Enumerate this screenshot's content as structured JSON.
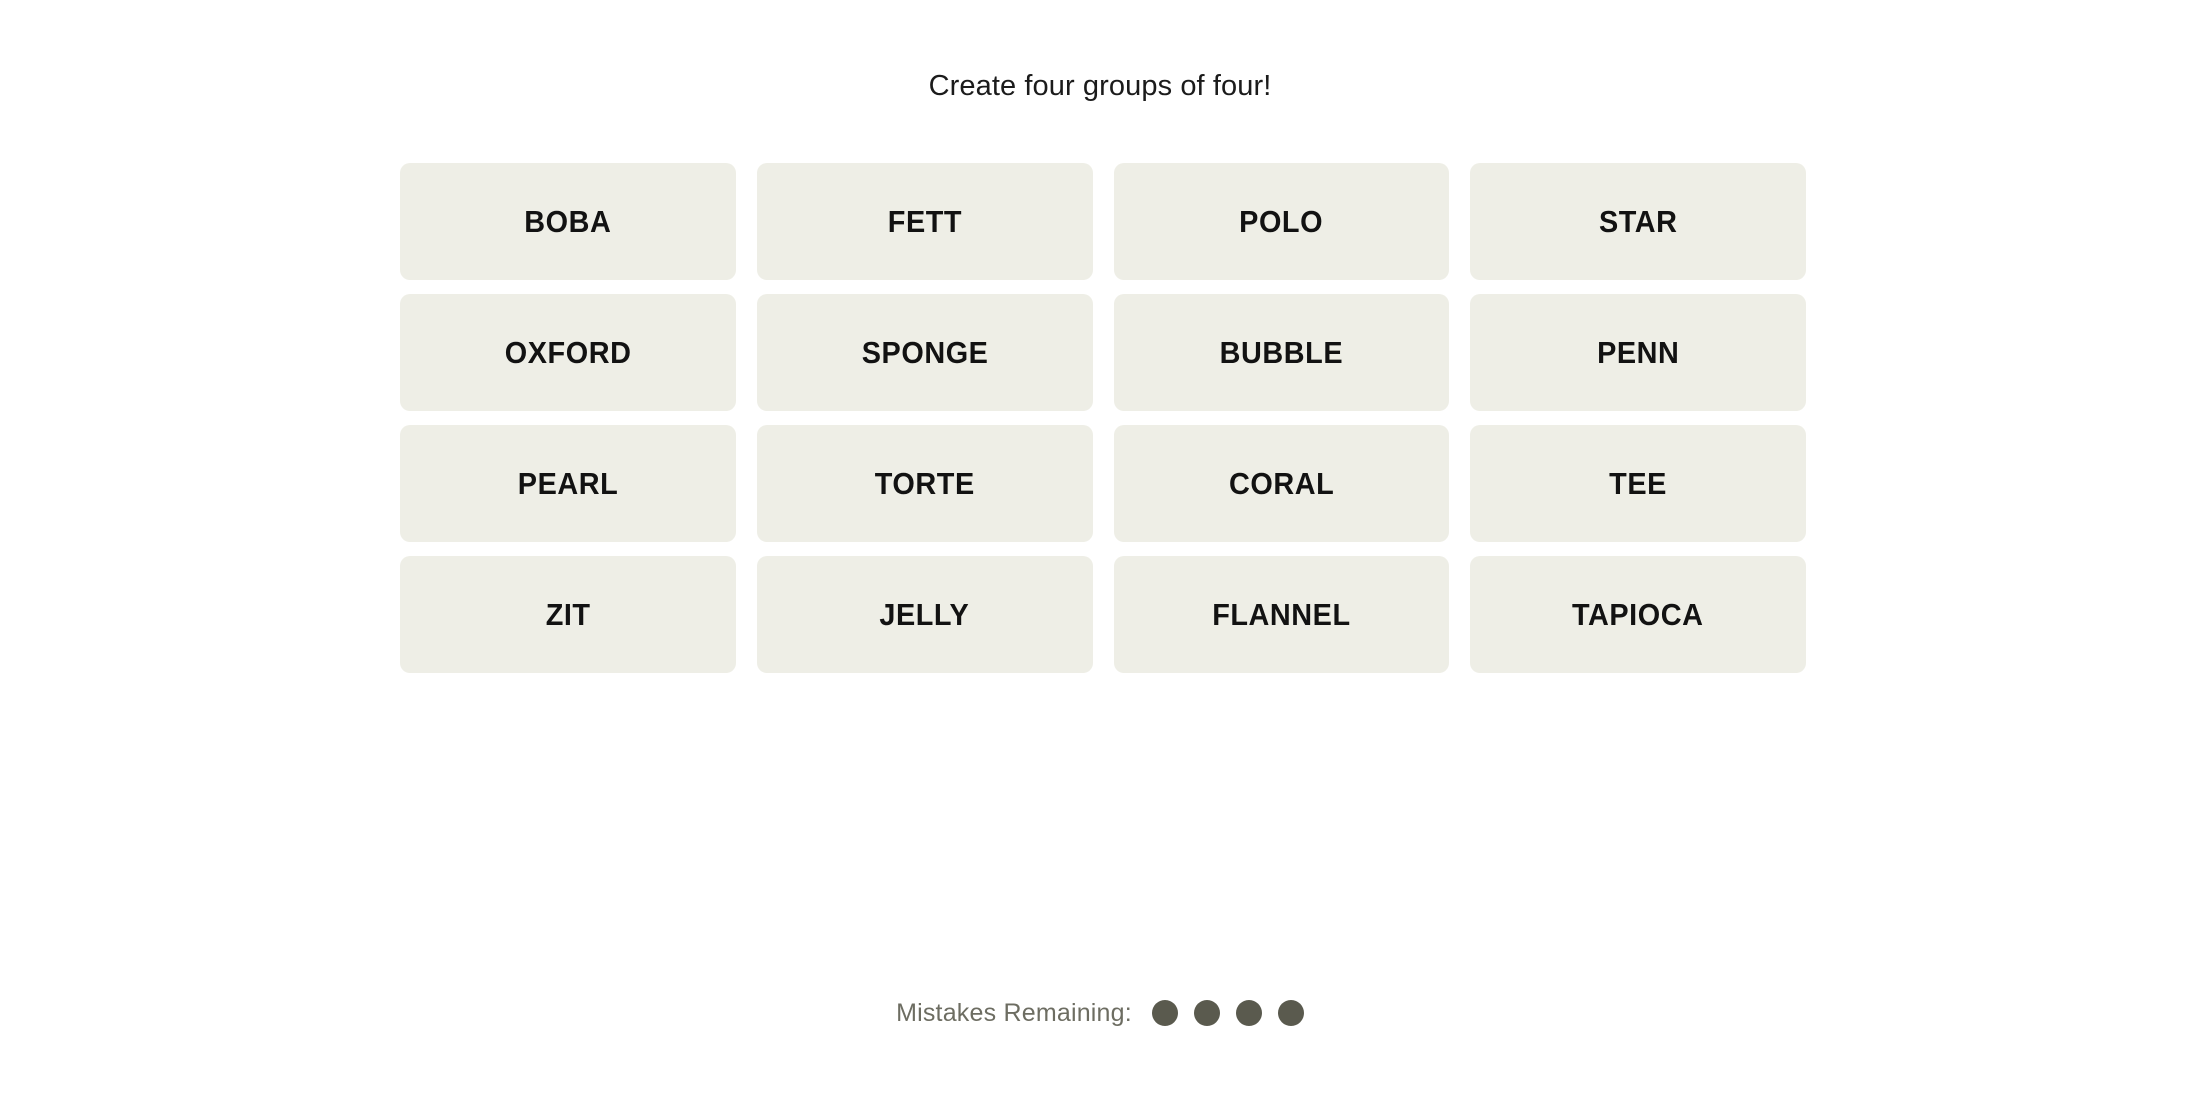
{
  "header": {
    "headline": "Create four groups of four!"
  },
  "board": {
    "rows": 4,
    "columns": 4,
    "tiles": [
      {
        "label": "BOBA"
      },
      {
        "label": "FETT"
      },
      {
        "label": "POLO"
      },
      {
        "label": "STAR"
      },
      {
        "label": "OXFORD"
      },
      {
        "label": "SPONGE"
      },
      {
        "label": "BUBBLE"
      },
      {
        "label": "PENN"
      },
      {
        "label": "PEARL"
      },
      {
        "label": "TORTE"
      },
      {
        "label": "CORAL"
      },
      {
        "label": "TEE"
      },
      {
        "label": "ZIT"
      },
      {
        "label": "JELLY"
      },
      {
        "label": "FLANNEL"
      },
      {
        "label": "TAPIOCA"
      }
    ]
  },
  "footer": {
    "mistakes_label": "Mistakes Remaining:",
    "mistakes_remaining": 4,
    "dots": [
      {
        "state": "filled"
      },
      {
        "state": "filled"
      },
      {
        "state": "filled"
      },
      {
        "state": "filled"
      }
    ]
  },
  "colors": {
    "page_background": "#ffffff",
    "tile_background": "#eeeee6",
    "tile_text": "#121212",
    "header_text": "#1b1b1b",
    "mistakes_label_text": "#6d6d62",
    "mistake_dot": "#5a5a4e"
  }
}
